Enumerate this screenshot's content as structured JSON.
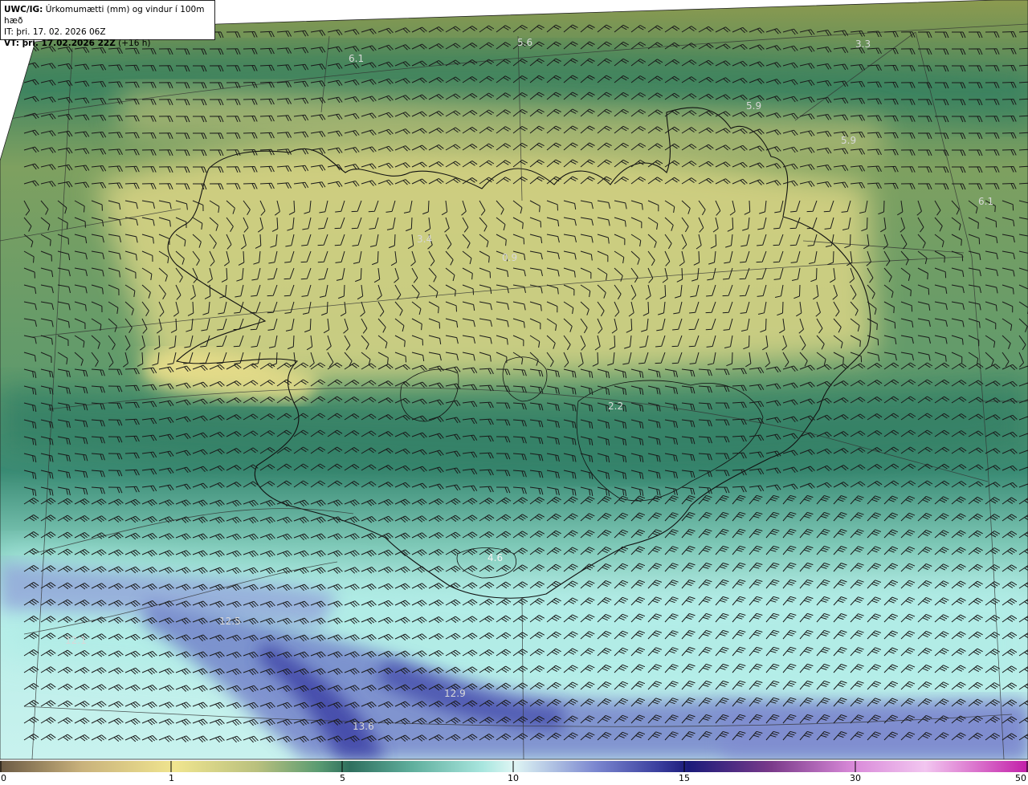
{
  "title": {
    "model": "UWC/IG:",
    "description": "Úrkomumætti (mm) og vindur í 100m hæð",
    "it_label": "IT:",
    "it_value": "þri. 17. 02. 2026 06Z",
    "vt_label": "VT: þri. 17.02.2026 22Z",
    "vt_offset": "(+16 h)"
  },
  "value_labels": [
    {
      "text": "6.1"
    },
    {
      "text": "5.6"
    },
    {
      "text": "3.3"
    },
    {
      "text": "5.9"
    },
    {
      "text": "5.9"
    },
    {
      "text": "6.1"
    },
    {
      "text": "3.4"
    },
    {
      "text": "0.9"
    },
    {
      "text": "2.2"
    },
    {
      "text": "4.6"
    },
    {
      "text": "12.5"
    },
    {
      "text": "12.1"
    },
    {
      "text": "12.9"
    },
    {
      "text": "13.6"
    }
  ],
  "colorbar": {
    "ticks": [
      "0",
      "1",
      "5",
      "10",
      "15",
      "30",
      "50"
    ],
    "colors": [
      "#6b5a44",
      "#c9b27c",
      "#f0e58f",
      "#b9c07e",
      "#5a9b72",
      "#2f6f5e",
      "#5fae9c",
      "#a9e6df",
      "#dff6f4",
      "#7a86cf",
      "#3b3f9e",
      "#1b1b7a",
      "#7a3a8a",
      "#d98ad9",
      "#f2c6f0",
      "#c21fa8"
    ]
  },
  "colors": {
    "ocean_far": "#6c8f3f",
    "ocean_green": "#3f8b6a",
    "land_yellow": "#efe28c",
    "cyan": "#a8e8e2",
    "heavy_precip": "#4048a8"
  }
}
